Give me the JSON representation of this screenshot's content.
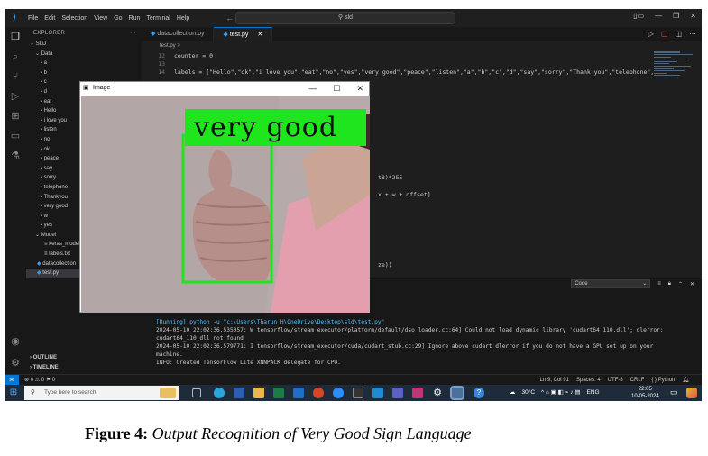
{
  "titlebar": {
    "menus": [
      "File",
      "Edit",
      "Selection",
      "View",
      "Go",
      "Run",
      "Terminal",
      "Help"
    ],
    "search": "sld"
  },
  "explorer": {
    "title": "EXPLORER",
    "root": "SLD",
    "folders": [
      "Data",
      "a",
      "b",
      "c",
      "d",
      "eat",
      "Hello",
      "i love you",
      "listen",
      "no",
      "ok",
      "peace",
      "say",
      "sorry",
      "telephone",
      "Thankyou",
      "very good",
      "w",
      "yes",
      "Model"
    ],
    "model_files": [
      "keras_model",
      "labels.txt"
    ],
    "files": [
      "datacollection",
      "test.py"
    ],
    "outline": "OUTLINE",
    "timeline": "TIMELINE"
  },
  "tabs": [
    "datacollection.py",
    "test.py"
  ],
  "breadcrumb": "test.py >",
  "code": {
    "l12": "counter = 0",
    "l14": "labels = [\"Hello\",\"ok\",\"i love you\",\"eat\",\"no\",\"yes\",\"very good\",\"peace\",\"listen\",\"a\",\"b\",\"c\",\"d\",\"say\",\"sorry\",\"Thank you\",\"telephone\",",
    "frag1": "t8)*255",
    "frag2": "x + w + offset]",
    "frag3": "ze))"
  },
  "panel": {
    "dropdown": "Code"
  },
  "terminal": {
    "l1": "[Running] python -u \"c:\\Users\\Tharun H\\OneDrive\\Desktop\\sld\\test.py\"",
    "l2": "2024-05-10 22:02:36.535057: W tensorflow/stream_executor/platform/default/dso_loader.cc:64] Could not load dynamic library 'cudart64_110.dll'; dlerror:",
    "l3": "cudart64_110.dll not found",
    "l4": "2024-05-10 22:02:36.579771: I tensorflow/stream_executor/cuda/cudart_stub.cc:29] Ignore above cudart dlerror if you do not have a GPU set up on your",
    "l5": "machine.",
    "l6": "INFO: Created TensorFlow Lite XNNPACK delegate for CPU."
  },
  "statusbar": {
    "problems": "⊗ 0 ⚠ 0   ⚑ 0",
    "position": "Ln 9, Col 91",
    "spaces": "Spaces: 4",
    "encoding": "UTF-8",
    "eol": "CRLF",
    "language": "Python"
  },
  "taskbar": {
    "search_placeholder": "Type here to search",
    "weather": "30°C",
    "lang": "ENG",
    "time": "22:05",
    "date": "10-05-2024"
  },
  "image_window": {
    "title": "Image",
    "prediction": "very good",
    "box_color": "#1ee51e"
  },
  "caption": {
    "label": "Figure 4:",
    "text": "Output Recognition of Very Good Sign Language"
  }
}
